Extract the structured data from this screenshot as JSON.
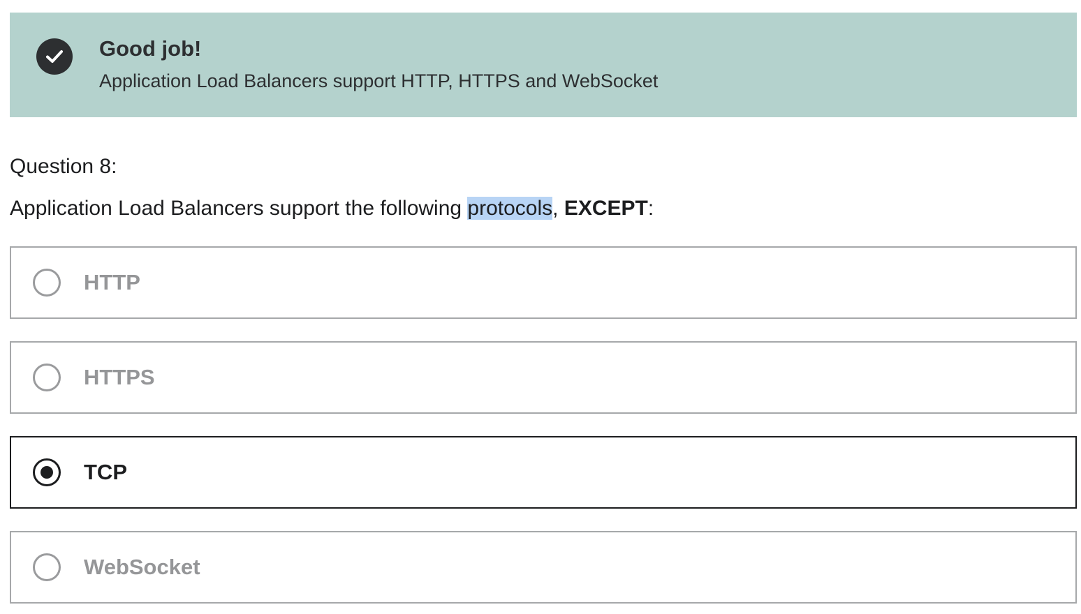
{
  "alert": {
    "icon": "check-circle-icon",
    "title": "Good job!",
    "message": "Application Load Balancers support HTTP, HTTPS and WebSocket",
    "background_color": "#b4d2cd"
  },
  "question": {
    "label": "Question 8:",
    "text_before": "Application Load Balancers support the following ",
    "text_highlighted": "protocols",
    "text_comma": ", ",
    "text_bold": "EXCEPT",
    "text_after": ":",
    "highlight_color": "#b8d4f5"
  },
  "options": [
    {
      "label": "HTTP",
      "selected": false
    },
    {
      "label": "HTTPS",
      "selected": false
    },
    {
      "label": "TCP",
      "selected": true
    },
    {
      "label": "WebSocket",
      "selected": false
    }
  ]
}
